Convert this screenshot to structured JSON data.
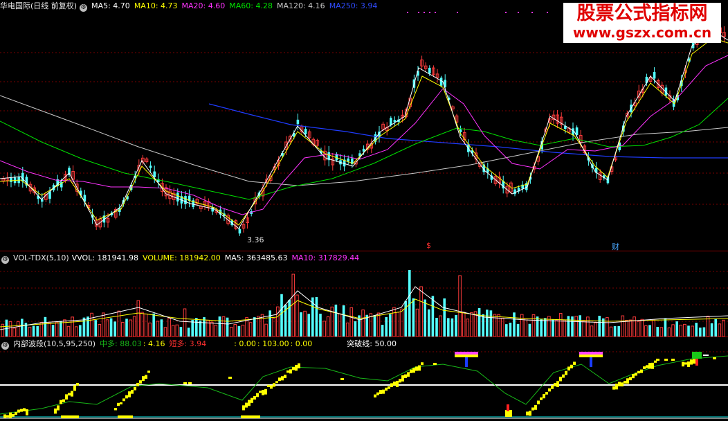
{
  "main_header": {
    "title": "华电国际(日线 前复权)",
    "ma5": "MA5: 4.70",
    "ma10": "MA10: 4.73",
    "ma20": "MA20: 4.60",
    "ma60": "MA60: 4.28",
    "ma120": "MA120: 4.16",
    "ma250": "MA250: 3.94"
  },
  "main_annotations": {
    "low_price": "3.36",
    "event_marker": "$",
    "finance_marker": "财"
  },
  "vol_header": {
    "name": "VOL-TDX(5,10)",
    "vvol": "VVOL: 181941.98",
    "volume": "VOLUME: 181942.00",
    "ma5": "MA5: 363485.63",
    "ma10": "MA10: 317829.44"
  },
  "ind_header": {
    "name": "内部波段(10,5,95,250)",
    "mid": "中多: 88.03",
    "v2": ": 4.16",
    "short": "短多: 3.94",
    "v4": ": 0.00",
    "v5": ": 103.00",
    "v6": ": 0.00",
    "breakline": "突破线: 50.00"
  },
  "watermark": {
    "line1": "股票公式指标网",
    "line2": "www.gszx.com.cn"
  },
  "colors": {
    "up": "#ff3c3c",
    "down": "#54ffff",
    "ma5": "#ffffff",
    "ma10": "#ffff00",
    "ma20": "#ff33ff",
    "ma60": "#00e000",
    "ma120": "#c8c8c8",
    "ma250": "#1f3cff"
  }
}
